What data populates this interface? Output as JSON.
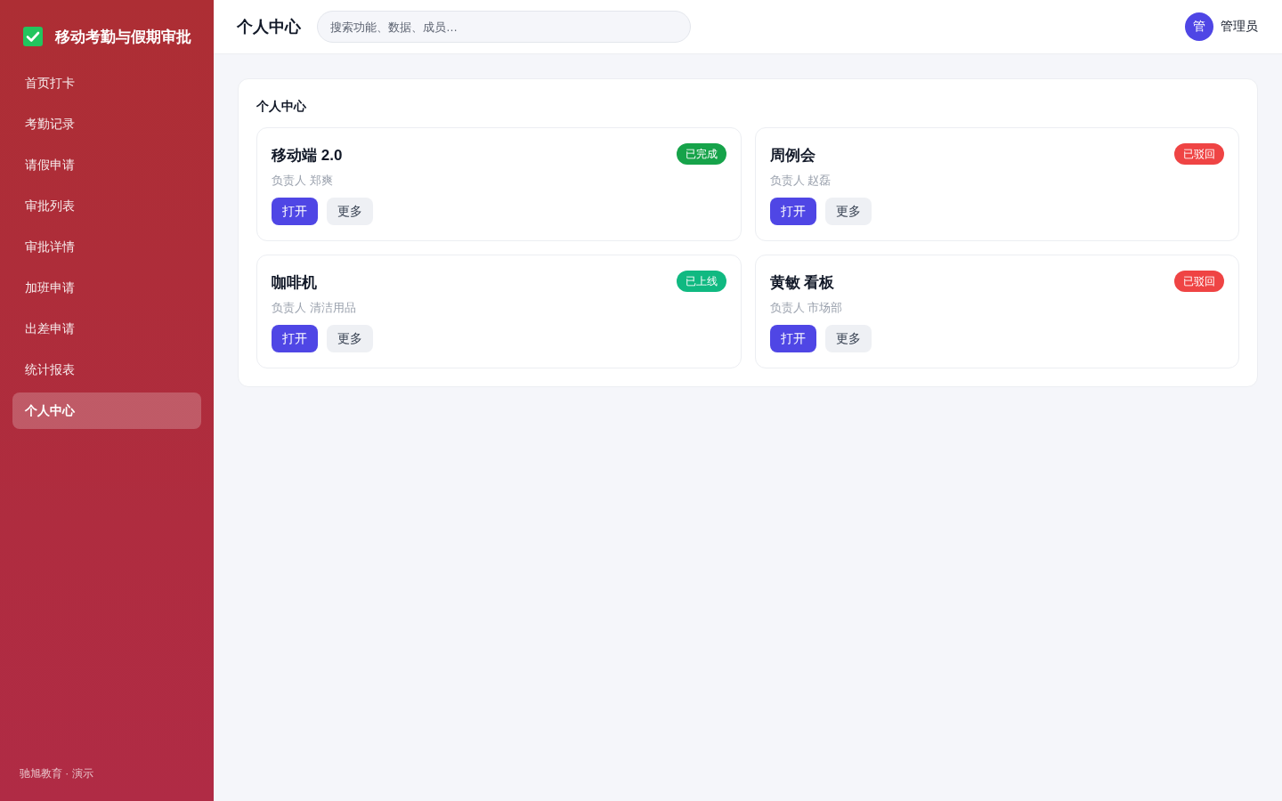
{
  "sidebar": {
    "logo_title": "移动考勤与假期审批",
    "items": [
      {
        "label": "首页打卡",
        "selected": false
      },
      {
        "label": "考勤记录",
        "selected": false
      },
      {
        "label": "请假申请",
        "selected": false
      },
      {
        "label": "审批列表",
        "selected": false
      },
      {
        "label": "审批详情",
        "selected": false
      },
      {
        "label": "加班申请",
        "selected": false
      },
      {
        "label": "出差申请",
        "selected": false
      },
      {
        "label": "统计报表",
        "selected": false
      },
      {
        "label": "个人中心",
        "selected": true
      }
    ],
    "footer": "驰旭教育 · 演示"
  },
  "header": {
    "title": "个人中心",
    "search": {
      "placeholder": "搜索功能、数据、成员…"
    },
    "user": {
      "avatar": "管",
      "name": "管理员"
    }
  },
  "panel": {
    "title": "个人中心",
    "cards": [
      {
        "title": "移动端 2.0",
        "status": "已完成",
        "color": "#16a34a",
        "owner": "负责人 郑爽",
        "buttons": [
          {
            "label": "打开",
            "kind": "primary"
          },
          {
            "label": "更多",
            "kind": "secondary"
          }
        ]
      },
      {
        "title": "周例会",
        "status": "已驳回",
        "color": "#ef4444",
        "owner": "负责人 赵磊",
        "buttons": [
          {
            "label": "打开",
            "kind": "primary"
          },
          {
            "label": "更多",
            "kind": "secondary"
          }
        ]
      },
      {
        "title": "咖啡机",
        "status": "已上线",
        "color": "#10b981",
        "owner": "负责人 清洁用品",
        "buttons": [
          {
            "label": "打开",
            "kind": "primary"
          },
          {
            "label": "更多",
            "kind": "secondary"
          }
        ]
      },
      {
        "title": "黄敏 看板",
        "status": "已驳回",
        "color": "#ef4444",
        "owner": "负责人 市场部",
        "buttons": [
          {
            "label": "打开",
            "kind": "primary"
          },
          {
            "label": "更多",
            "kind": "secondary"
          }
        ]
      }
    ]
  }
}
